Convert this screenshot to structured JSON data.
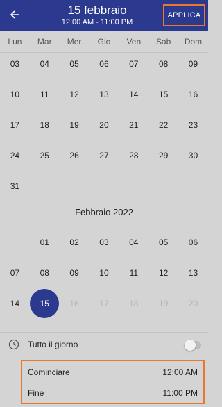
{
  "header": {
    "title": "15  febbraio",
    "subtitle": "12:00 AM - 11:00 PM",
    "apply_label": "APPLICA",
    "background": "#2b3a8f",
    "highlight_color": "#e8782e"
  },
  "weekdays": [
    "Lun",
    "Mar",
    "Mer",
    "Gio",
    "Ven",
    "Sab",
    "Dom"
  ],
  "january_weeks": [
    [
      "03",
      "04",
      "05",
      "06",
      "07",
      "08",
      "09"
    ],
    [
      "10",
      "11",
      "12",
      "13",
      "14",
      "15",
      "16"
    ],
    [
      "17",
      "18",
      "19",
      "20",
      "21",
      "22",
      "23"
    ],
    [
      "24",
      "25",
      "26",
      "27",
      "28",
      "29",
      "30"
    ],
    [
      "31",
      "",
      "",
      "",
      "",
      "",
      ""
    ]
  ],
  "february": {
    "label": "Febbraio 2022",
    "weeks": [
      [
        "",
        "01",
        "02",
        "03",
        "04",
        "05",
        "06"
      ],
      [
        "07",
        "08",
        "09",
        "10",
        "11",
        "12",
        "13"
      ],
      [
        "14",
        "15",
        "16",
        "17",
        "18",
        "19",
        "20"
      ]
    ],
    "selected_day": "15",
    "disabled_after": "15"
  },
  "all_day": {
    "label": "Tutto il giorno",
    "enabled": false,
    "icon": "clock-icon"
  },
  "start": {
    "label": "Cominciare",
    "value": "12:00 AM"
  },
  "end": {
    "label": "Fine",
    "value": "11:00 PM"
  }
}
